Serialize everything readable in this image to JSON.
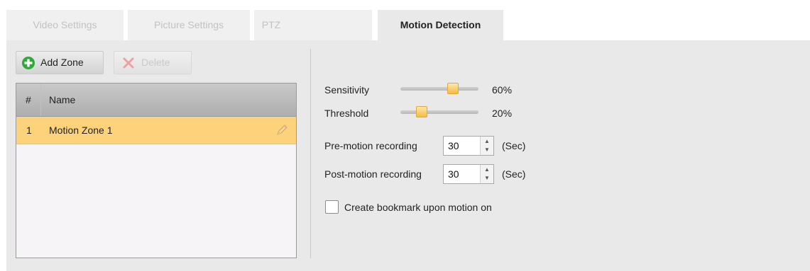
{
  "tabs": [
    {
      "label": "Video Settings",
      "active": false
    },
    {
      "label": "Picture Settings",
      "active": false
    },
    {
      "label": "PTZ",
      "active": false
    },
    {
      "label": "Motion Detection",
      "active": true
    }
  ],
  "toolbar": {
    "add_zone_label": "Add Zone",
    "delete_label": "Delete"
  },
  "zones_table": {
    "columns": [
      "#",
      "Name"
    ],
    "rows": [
      {
        "index": "1",
        "name": "Motion Zone 1",
        "selected": true
      }
    ]
  },
  "settings": {
    "sensitivity": {
      "label": "Sensitivity",
      "value_text": "60%",
      "value": 0.6
    },
    "threshold": {
      "label": "Threshold",
      "value_text": "20%",
      "value": 0.2
    },
    "pre_motion": {
      "label": "Pre-motion recording",
      "value": "30",
      "unit": "(Sec)"
    },
    "post_motion": {
      "label": "Post-motion recording",
      "value": "30",
      "unit": "(Sec)"
    },
    "bookmark": {
      "label": "Create bookmark upon motion on",
      "checked": false
    }
  },
  "colors": {
    "selected_row": "#fcd37a",
    "slider_thumb": "#f5bc42",
    "add_icon": "#2fa93a",
    "delete_icon_disabled": "#f0a0a0"
  }
}
